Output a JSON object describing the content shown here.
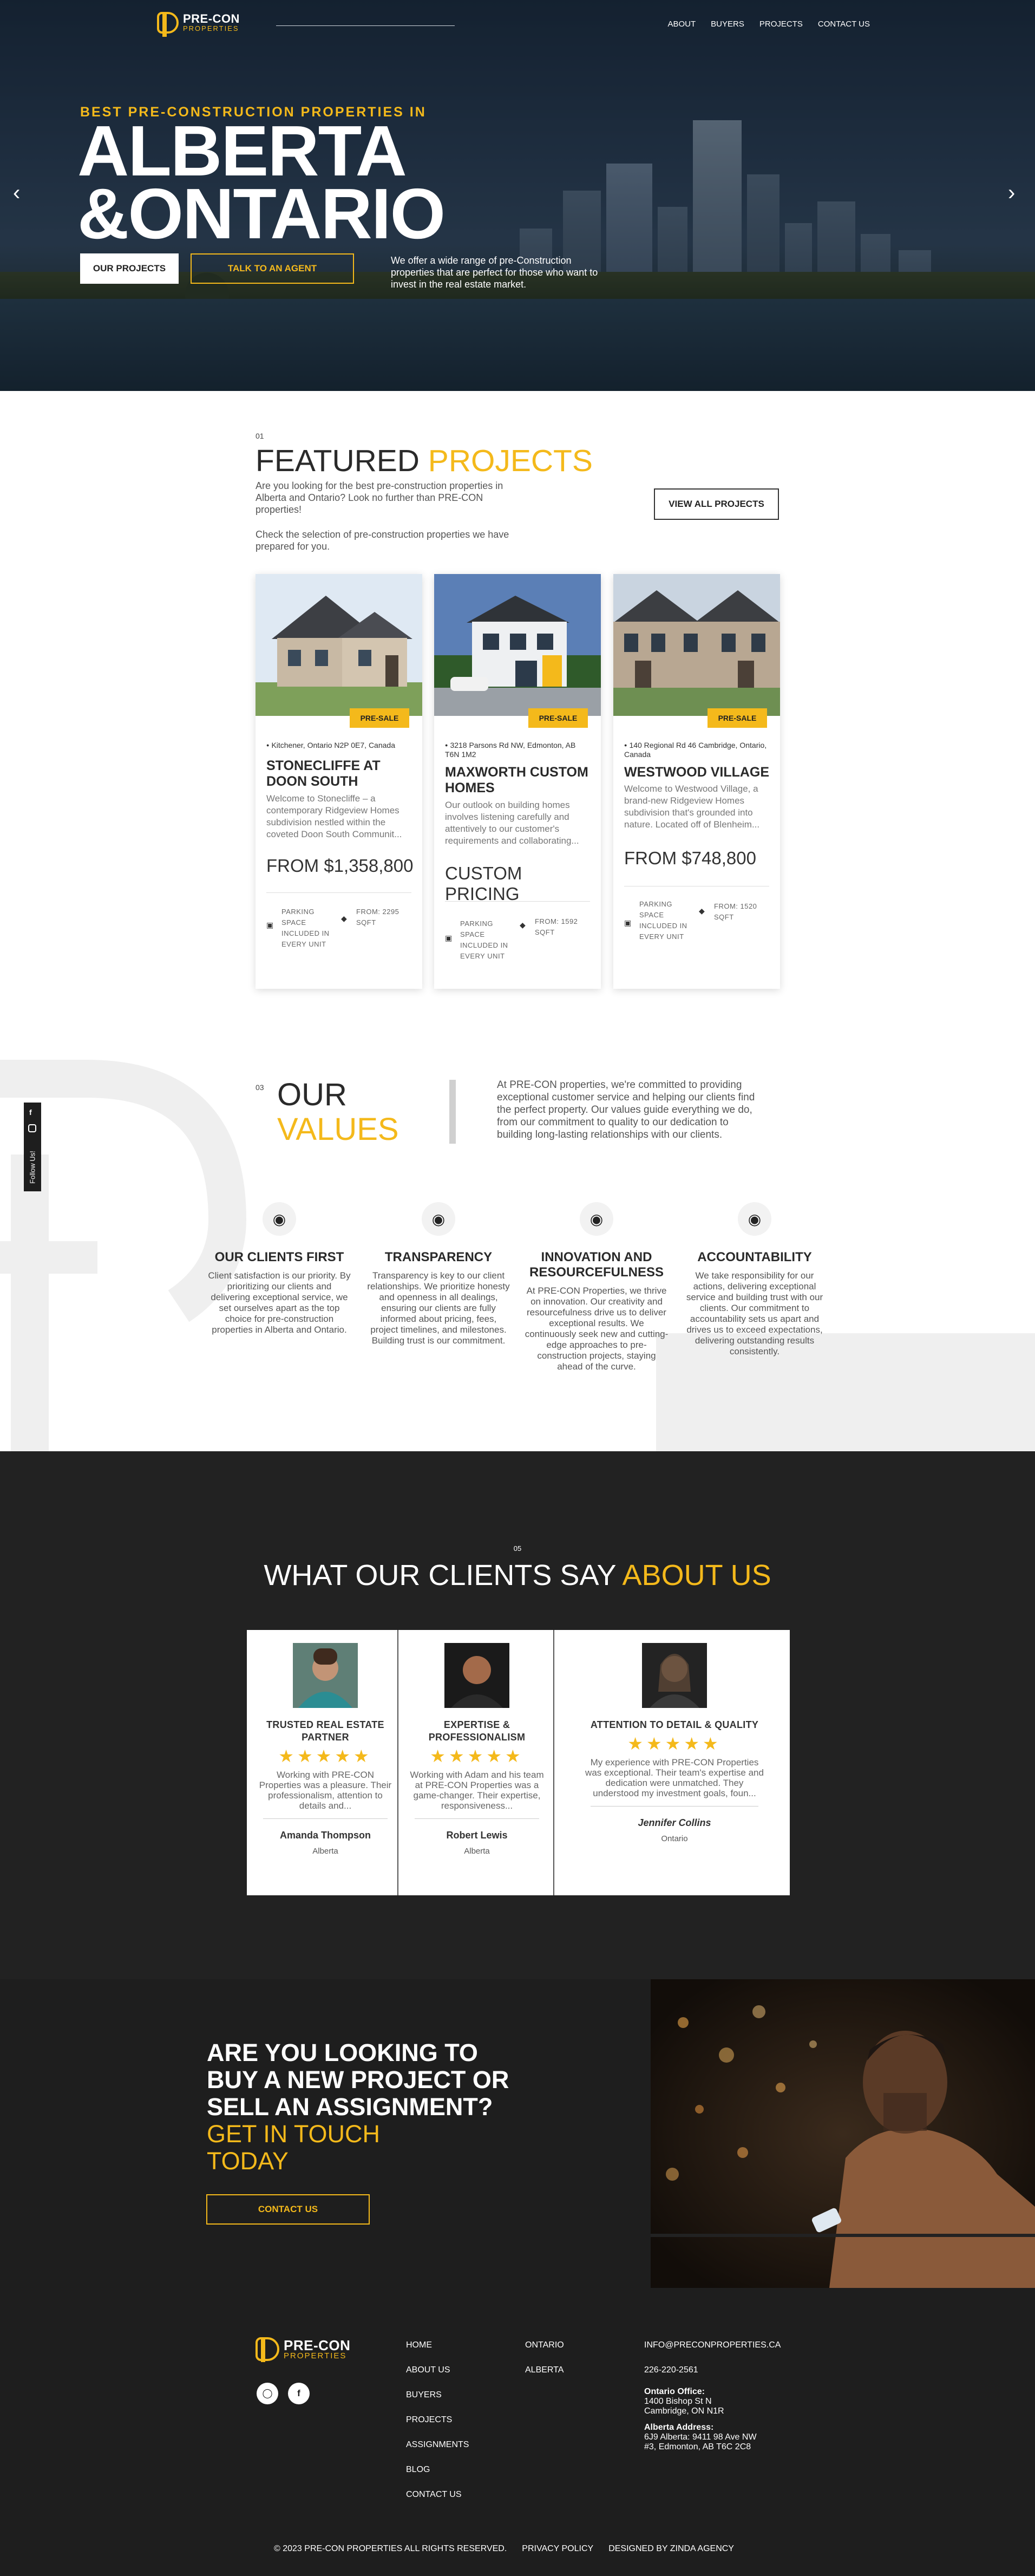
{
  "header": {
    "brand_line1": "PRE-CON",
    "brand_line2": "PROPERTIES",
    "nav": [
      "ABOUT",
      "BUYERS",
      "PROJECTS",
      "CONTACT US"
    ]
  },
  "hero": {
    "kicker": "BEST PRE-CONSTRUCTION PROPERTIES IN",
    "line1": "ALBERTA",
    "line2": "&ONTARIO",
    "btn_projects": "OUR PROJECTS",
    "btn_agent": "TALK TO AN AGENT",
    "description": "We offer a wide range of pre-Construction properties that are perfect for those who want to invest in the real estate market.",
    "prev_icon": "chevron-left-icon",
    "next_icon": "chevron-right-icon"
  },
  "featured": {
    "number": "01",
    "title_a": "FEATURED ",
    "title_b": "PROJECTS",
    "intro1": "Are you looking for the best pre-construction properties in Alberta and Ontario? Look no further than PRE-CON properties!",
    "intro2": "Check the selection of pre-construction properties we have prepared for you.",
    "view_all": "VIEW ALL PROJECTS",
    "cards": [
      {
        "badge": "PRE-SALE",
        "address": "Kitchener, Ontario N2P 0E7, Canada",
        "name": "STONECLIFFE AT DOON SOUTH",
        "desc": "Welcome to Stonecliffe – a contemporary Ridgeview Homes subdivision nestled within the coveted Doon South Communit...",
        "price": "FROM $1,358,800",
        "feature1": "PARKING SPACE INCLUDED IN EVERY UNIT",
        "feature2": "FROM: 2295 SQFT"
      },
      {
        "badge": "PRE-SALE",
        "address": "3218 Parsons Rd NW, Edmonton, AB T6N 1M2",
        "name": "MAXWORTH CUSTOM HOMES",
        "desc": "Our outlook on building homes involves listening carefully and attentively to our customer's requirements and collaborating...",
        "price": "CUSTOM PRICING",
        "feature1": "PARKING SPACE INCLUDED IN EVERY UNIT",
        "feature2": "FROM: 1592 SQFT"
      },
      {
        "badge": "PRE-SALE",
        "address": "140 Regional Rd 46 Cambridge, Ontario, Canada",
        "name": "WESTWOOD VILLAGE",
        "desc": "Welcome to Westwood Village, a brand-new Ridgeview Homes subdivision that's grounded into nature. Located off of Blenheim...",
        "price": "FROM $748,800",
        "feature1": "PARKING SPACE INCLUDED IN EVERY UNIT",
        "feature2": "FROM: 1520 SQFT"
      }
    ]
  },
  "values": {
    "number": "03",
    "title_a": "OUR",
    "title_b": "VALUES",
    "follow_label": "Follow Us!",
    "intro": "At PRE-CON properties, we're committed to providing exceptional customer service and helping our clients find the perfect property. Our values guide everything we do, from our commitment to quality to our dedication to building long-lasting relationships with our clients.",
    "items": [
      {
        "title": "OUR CLIENTS FIRST",
        "text": "Client satisfaction is our priority. By prioritizing our clients and delivering exceptional service, we set ourselves apart as the top choice for pre-construction properties in Alberta and Ontario."
      },
      {
        "title": "TRANSPARENCY",
        "text": "Transparency is key to our client relationships. We prioritize honesty and openness in all dealings, ensuring our clients are fully informed about pricing, fees, project timelines, and milestones. Building trust is our commitment."
      },
      {
        "title": "INNOVATION AND RESOURCEFULNESS",
        "text": "At PRE-CON Properties, we thrive on innovation. Our creativity and resourcefulness drive us to deliver exceptional results. We continuously seek new and cutting-edge approaches to pre-construction projects, staying ahead of the curve."
      },
      {
        "title": "ACCOUNTABILITY",
        "text": "We take responsibility for our actions, delivering exceptional service and building trust with our clients. Our commitment to accountability sets us apart and drives us to exceed expectations, delivering outstanding results consistently."
      }
    ]
  },
  "testimonials": {
    "number": "05",
    "title_a": "WHAT OUR CLIENTS SAY ",
    "title_b": "ABOUT US",
    "stars": "★★★★★",
    "items": [
      {
        "heading": "TRUSTED REAL ESTATE PARTNER",
        "text": "Working with PRE-CON Properties was a pleasure. Their professionalism, attention to details and...",
        "name": "Amanda Thompson",
        "location": "Alberta"
      },
      {
        "heading": "EXPERTISE & PROFESSIONALISM",
        "text": "Working with Adam and his team at PRE-CON Properties was a game-changer. Their expertise, responsiveness...",
        "name": "Robert Lewis",
        "location": "Alberta"
      },
      {
        "heading": "ATTENTION TO DETAIL & QUALITY",
        "text": "My experience with PRE-CON Properties was exceptional. Their team's expertise and dedication were unmatched. They understood my investment goals, foun...",
        "name": "Jennifer Collins",
        "location": "Ontario"
      }
    ]
  },
  "cta": {
    "line1": "ARE YOU LOOKING TO",
    "line2": "BUY A NEW PROJECT OR",
    "line3": "SELL AN ASSIGNMENT?",
    "line4": "GET IN TOUCH",
    "line5": "TODAY",
    "button": "CONTACT US"
  },
  "footer": {
    "links_col1": [
      "HOME",
      "ABOUT US",
      "BUYERS",
      "PROJECTS",
      "ASSIGNMENTS",
      "BLOG",
      "CONTACT US"
    ],
    "links_col2": [
      "ONTARIO",
      "ALBERTA"
    ],
    "email": "INFO@PRECONPROPERTIES.CA",
    "phone": "226-220-2561",
    "ontario_label": "Ontario Office:",
    "ontario_addr1": "1400 Bishop St N",
    "ontario_addr2": "Cambridge, ON N1R",
    "alberta_label": "Alberta Address:",
    "alberta_addr1": "6J9 Alberta: 9411 98 Ave NW",
    "alberta_addr2": "#3, Edmonton, AB T6C 2C8",
    "copyright": "© 2023 PRE-CON PROPERTIES ALL RIGHTS RESERVED.",
    "privacy": "PRIVACY POLICY",
    "designed": "DESIGNED BY ZINDA AGENCY",
    "social": [
      "instagram-icon",
      "facebook-icon"
    ]
  },
  "colors": {
    "accent": "#f4b91b",
    "dark": "#1e1e1e",
    "testimonial_bg": "#222222"
  }
}
